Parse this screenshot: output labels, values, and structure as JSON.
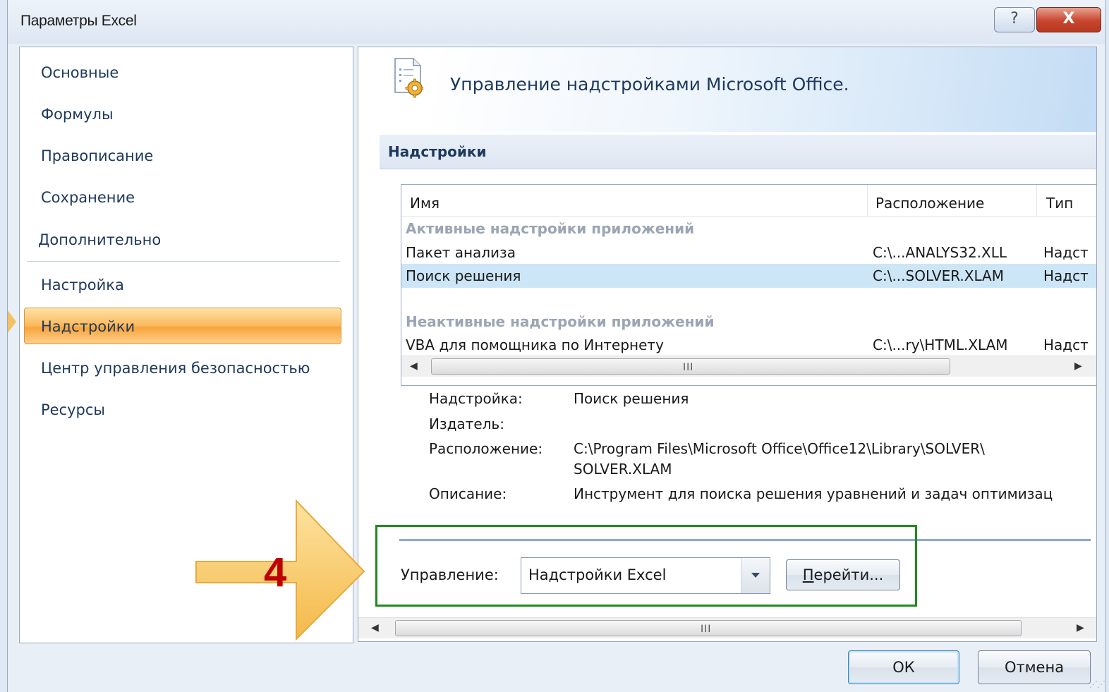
{
  "window": {
    "title": "Параметры Excel",
    "help_glyph": "?",
    "close_glyph": "X"
  },
  "sidebar": {
    "items": [
      {
        "label": "Основные"
      },
      {
        "label": "Формулы"
      },
      {
        "label": "Правописание"
      },
      {
        "label": "Сохранение"
      },
      {
        "label": "Дополнительно"
      },
      {
        "label": "Настройка"
      },
      {
        "label": "Надстройки"
      },
      {
        "label": "Центр управления безопасностью"
      },
      {
        "label": "Ресурсы"
      }
    ],
    "active_index": 6
  },
  "main": {
    "banner_text": "Управление надстройками Microsoft Office.",
    "section_title": "Надстройки",
    "table": {
      "columns": [
        "Имя",
        "Расположение",
        "Тип"
      ],
      "groups": [
        {
          "title": "Активные надстройки приложений",
          "rows": [
            {
              "name": "Пакет анализа",
              "location": "C:\\...ANALYS32.XLL",
              "type": "Надст"
            },
            {
              "name": "Поиск решения",
              "location": "C:\\...SOLVER.XLAM",
              "type": "Надст",
              "selected": true
            }
          ]
        },
        {
          "title": "Неактивные надстройки приложений",
          "rows": [
            {
              "name": "VBA для помощника по Интернету",
              "location": "C:\\...ry\\HTML.XLAM",
              "type": "Надст"
            }
          ]
        }
      ],
      "scroll_grip": "III"
    },
    "details": {
      "addin_label": "Надстройка:",
      "addin_value": "Поиск решения",
      "publisher_label": "Издатель:",
      "location_label": "Расположение:",
      "location_value_line1": "C:\\Program Files\\Microsoft Office\\Office12\\Library\\SOLVER\\",
      "location_value_line2": "SOLVER.XLAM",
      "description_label": "Описание:",
      "description_value": "Инструмент для поиска решения уравнений и задач оптимизац"
    },
    "manage": {
      "label": "Управление:",
      "selected": "Надстройки Excel",
      "go_button_accel": "П",
      "go_button_rest": "ерейти..."
    },
    "bottom_scroll_grip": "III"
  },
  "footer": {
    "ok_label": "ОК",
    "cancel_label": "Отмена"
  },
  "annotation": {
    "step_number": "4",
    "arrow_color": "#f4c25f",
    "highlight_color": "#1f8a1f",
    "number_color": "#c00000"
  }
}
